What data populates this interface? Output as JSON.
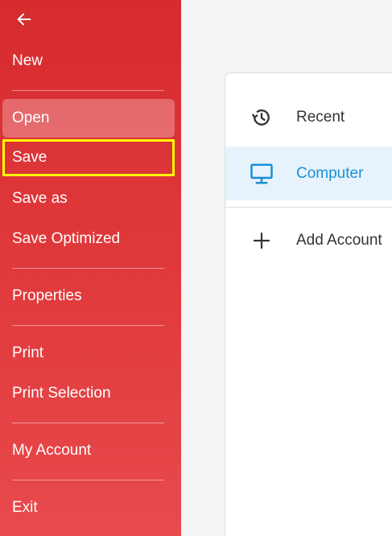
{
  "sidebar": {
    "back_icon": "arrow-left-icon",
    "items": [
      {
        "label": "New"
      },
      {
        "label": "Open"
      },
      {
        "label": "Save"
      },
      {
        "label": "Save as"
      },
      {
        "label": "Save Optimized"
      },
      {
        "label": "Properties"
      },
      {
        "label": "Print"
      },
      {
        "label": "Print Selection"
      },
      {
        "label": "My Account"
      },
      {
        "label": "Exit"
      }
    ],
    "active_item": "Open",
    "focused_item": "Save"
  },
  "locations": {
    "items": [
      {
        "label": "Recent",
        "icon": "history-icon"
      },
      {
        "label": "Computer",
        "icon": "monitor-icon"
      },
      {
        "label": "Add Account",
        "icon": "plus-icon"
      }
    ],
    "selected_item": "Computer"
  },
  "colors": {
    "sidebar_top": "#d62b2f",
    "sidebar_bottom": "#e84a4d",
    "focus_outline": "#ffff00",
    "selected_text": "#1a8fd6",
    "selected_bg": "#e6f3fc"
  }
}
